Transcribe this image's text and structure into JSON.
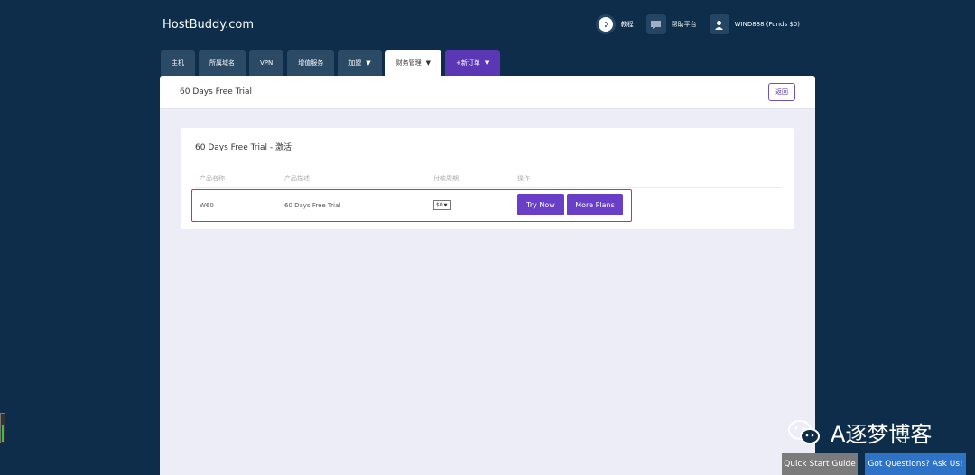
{
  "header": {
    "logo": "HostBuddy.com",
    "nav": [
      {
        "icon": "tutorial-icon",
        "label": "教程"
      },
      {
        "icon": "help-icon",
        "label": "帮助平台"
      },
      {
        "icon": "user-icon",
        "label": "WIND888 (Funds $0)"
      }
    ]
  },
  "tabs": [
    {
      "label": "主机"
    },
    {
      "label": "所属域名"
    },
    {
      "label": "VPN"
    },
    {
      "label": "增值服务"
    },
    {
      "label": "加盟"
    },
    {
      "label": "财务管理"
    },
    {
      "label": "+新订单"
    }
  ],
  "panel": {
    "title": "60 Days Free Trial",
    "back_label": "返回"
  },
  "card": {
    "title": "60 Days Free Trial - 激活",
    "columns": [
      "产品名称",
      "产品描述",
      "付款周期",
      "操作"
    ],
    "row": {
      "name": "W60",
      "description": "60 Days Free Trial",
      "cycle": "$0",
      "try_label": "Try Now",
      "more_label": "More Plans"
    }
  },
  "watermark": "A逐梦博客",
  "bottom": {
    "quick_start": "Quick Start Guide",
    "questions": "Got Questions? Ask Us!"
  },
  "side_meter_level": 0.6,
  "colors": {
    "background": "#0d2d4a",
    "accent": "#6a3fc7",
    "highlight": "#e0302d",
    "ask_button": "#2f73c7"
  }
}
